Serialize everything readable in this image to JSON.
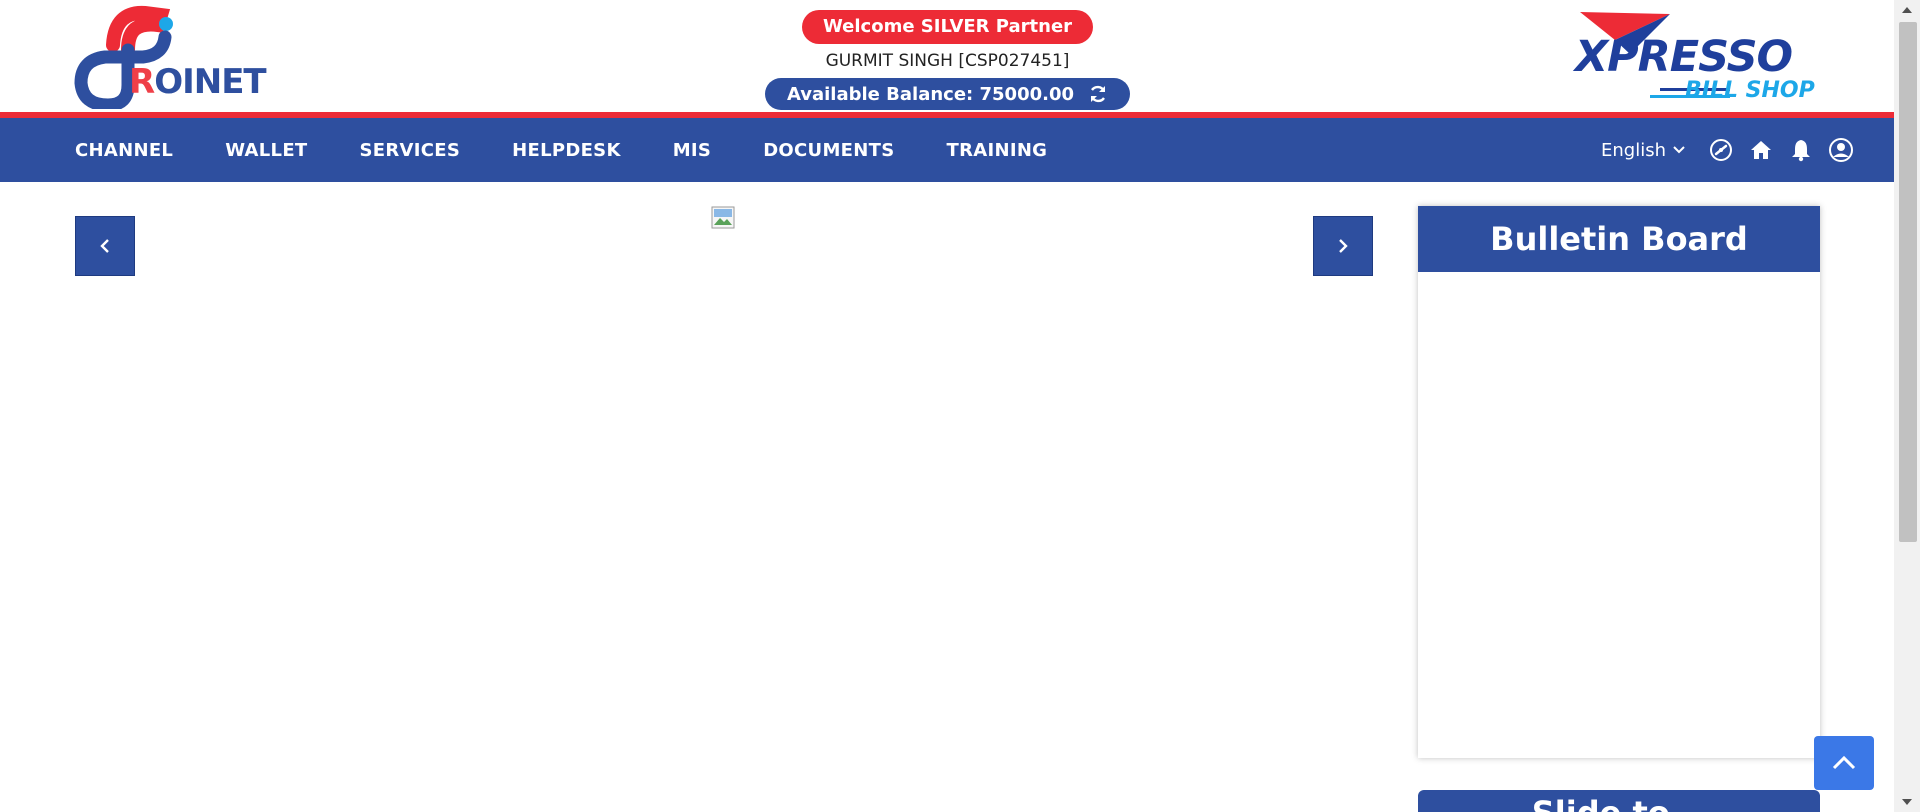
{
  "header": {
    "logo_left": {
      "prefix": "R",
      "text": "OINET"
    },
    "logo_right": {
      "top": "XPRESSO",
      "bottom": "BILL SHOP"
    },
    "welcome": "Welcome SILVER Partner",
    "user": "GURMIT SINGH [CSP027451]",
    "balance": "Available Balance: 75000.00"
  },
  "nav": {
    "items": [
      "CHANNEL",
      "WALLET",
      "SERVICES",
      "HELPDESK",
      "MIS",
      "DOCUMENTS",
      "TRAINING"
    ],
    "language": "English",
    "icons": [
      "dashboard-icon",
      "home-icon",
      "bell-icon",
      "user-profile-icon"
    ]
  },
  "colors": {
    "primary": "#2e4f9f",
    "accent_red": "#ed2b36",
    "back_to_top": "#3b78e7"
  },
  "bulletin": {
    "title": "Bulletin Board"
  },
  "panel2": {
    "title": "Slide to..."
  }
}
